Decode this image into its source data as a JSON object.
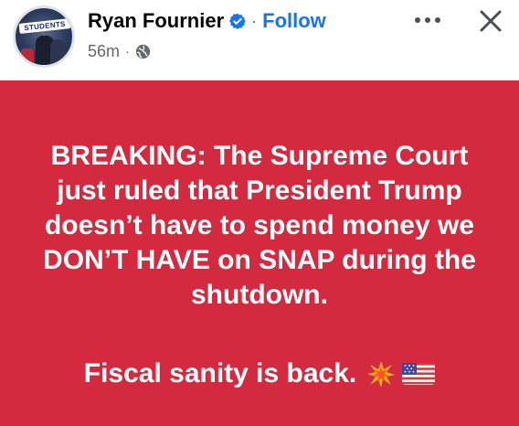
{
  "post": {
    "author": "Ryan Fournier",
    "separator": "·",
    "follow_label": "Follow",
    "timestamp": "56m",
    "meta_separator": "·",
    "avatar_text": "STUDENTS",
    "audience_icon": "globe-icon",
    "verified_icon": "verified-badge-icon",
    "more_icon": "more-options-icon",
    "close_icon": "close-icon",
    "body_text": "BREAKING: The Supreme Court just ruled that President Trump doesn’t have to spend money we DON’T HAVE on SNAP during the shutdown.",
    "closing_text": "Fiscal sanity is back.",
    "background_color": "#d32a3f",
    "text_color": "#ffffff",
    "follow_color": "#1b74e4"
  }
}
